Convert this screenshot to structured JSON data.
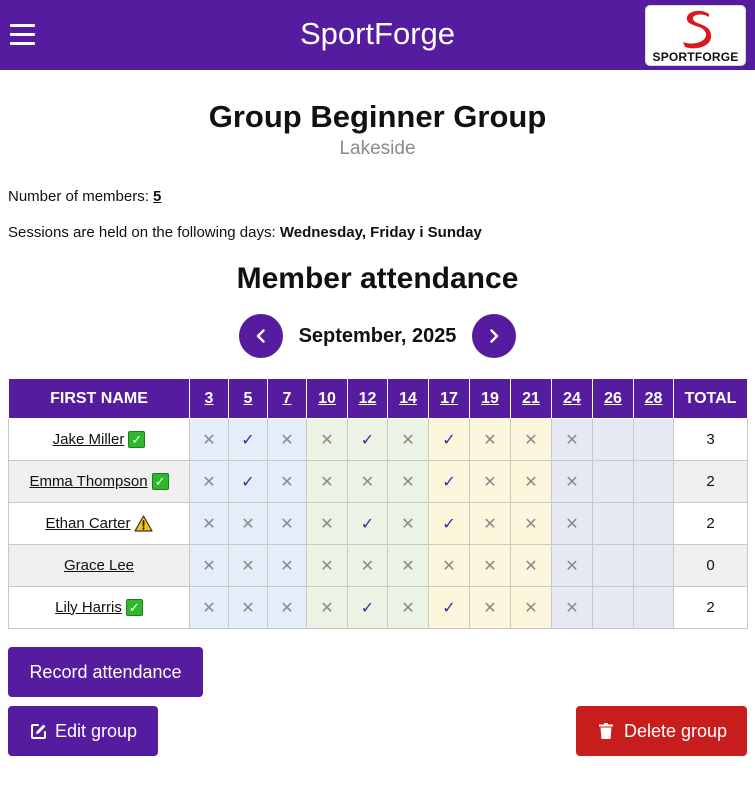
{
  "header": {
    "app_title": "SportForge",
    "menu_icon": "hamburger-icon",
    "logo_text": "SPORTFORGE",
    "brand_color": "#551ca0"
  },
  "group": {
    "title": "Group Beginner Group",
    "location": "Lakeside",
    "members_label": "Number of members: ",
    "members_count": "5",
    "sessions_label": "Sessions are held on the following days: ",
    "sessions_days": "Wednesday, Friday i Sunday"
  },
  "attendance": {
    "heading": "Member attendance",
    "month": "September, 2025",
    "columns": {
      "name": "FIRST NAME",
      "total": "TOTAL"
    },
    "days": [
      "3",
      "5",
      "7",
      "10",
      "12",
      "14",
      "17",
      "19",
      "21",
      "24",
      "26",
      "28"
    ],
    "members": [
      {
        "name": "Jake Miller",
        "status": "ok",
        "marks": [
          "x",
          "v",
          "x",
          "x",
          "v",
          "x",
          "v",
          "x",
          "x",
          "x",
          "",
          ""
        ],
        "total": "3"
      },
      {
        "name": "Emma Thompson",
        "status": "ok",
        "marks": [
          "x",
          "v",
          "x",
          "x",
          "x",
          "x",
          "v",
          "x",
          "x",
          "x",
          "",
          ""
        ],
        "total": "2"
      },
      {
        "name": "Ethan Carter",
        "status": "warn",
        "marks": [
          "x",
          "x",
          "x",
          "x",
          "v",
          "x",
          "v",
          "x",
          "x",
          "x",
          "",
          ""
        ],
        "total": "2"
      },
      {
        "name": "Grace Lee",
        "status": "none",
        "marks": [
          "x",
          "x",
          "x",
          "x",
          "x",
          "x",
          "x",
          "x",
          "x",
          "x",
          "",
          ""
        ],
        "total": "0"
      },
      {
        "name": "Lily Harris",
        "status": "ok",
        "marks": [
          "x",
          "x",
          "x",
          "x",
          "v",
          "x",
          "v",
          "x",
          "x",
          "x",
          "",
          ""
        ],
        "total": "2"
      }
    ]
  },
  "actions": {
    "record": "Record attendance",
    "edit": "Edit group",
    "delete": "Delete group",
    "delete_color": "#c81d1d"
  }
}
